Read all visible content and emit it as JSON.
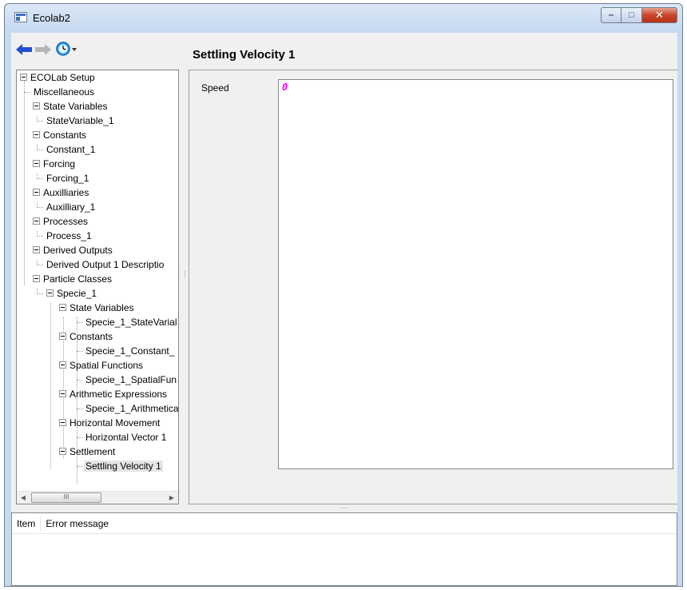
{
  "window": {
    "title": "Ecolab2",
    "minimize_glyph": "‒",
    "maximize_glyph": "□",
    "close_glyph": "✕"
  },
  "toolbar": {
    "back_icon": "back-arrow-icon",
    "forward_icon": "forward-arrow-icon",
    "history_icon": "clock-dropdown-icon"
  },
  "detail": {
    "heading": "Settling Velocity 1",
    "speed_label": "Speed",
    "speed_value": "0"
  },
  "tree": {
    "root": "ECOLab Setup",
    "misc": "Miscellaneous",
    "state_variables": "State Variables",
    "state_variable_1": "StateVariable_1",
    "constants": "Constants",
    "constant_1": "Constant_1",
    "forcing": "Forcing",
    "forcing_1": "Forcing_1",
    "auxilliaries": "Auxilliaries",
    "auxilliary_1": "Auxilliary_1",
    "processes": "Processes",
    "process_1": "Process_1",
    "derived_outputs": "Derived Outputs",
    "derived_output_1": "Derived Output 1 Descriptio",
    "particle_classes": "Particle Classes",
    "specie_1": "Specie_1",
    "sp_state_variables": "State Variables",
    "sp_state_variable": "Specie_1_StateVarial",
    "sp_constants": "Constants",
    "sp_constant": "Specie_1_Constant_",
    "sp_spatial_functions": "Spatial Functions",
    "sp_spatial_function": "Specie_1_SpatialFun",
    "sp_arithmetic": "Arithmetic Expressions",
    "sp_arithmetic_item": "Specie_1_Arithmetica",
    "sp_horizontal": "Horizontal Movement",
    "sp_horizontal_item": "Horizontal Vector 1",
    "sp_settlement": "Settlement",
    "sp_settling": "Settling Velocity 1"
  },
  "tree_scroll": {
    "left_glyph": "◀",
    "right_glyph": "▶",
    "thumb_glyph": "III"
  },
  "error_list": {
    "col_item": "Item",
    "col_error": "Error message"
  },
  "colors": {
    "speed_value": "#ff00ff",
    "arrow_blue": "#1f4fd1",
    "arrow_gray": "#b5b5b5"
  }
}
